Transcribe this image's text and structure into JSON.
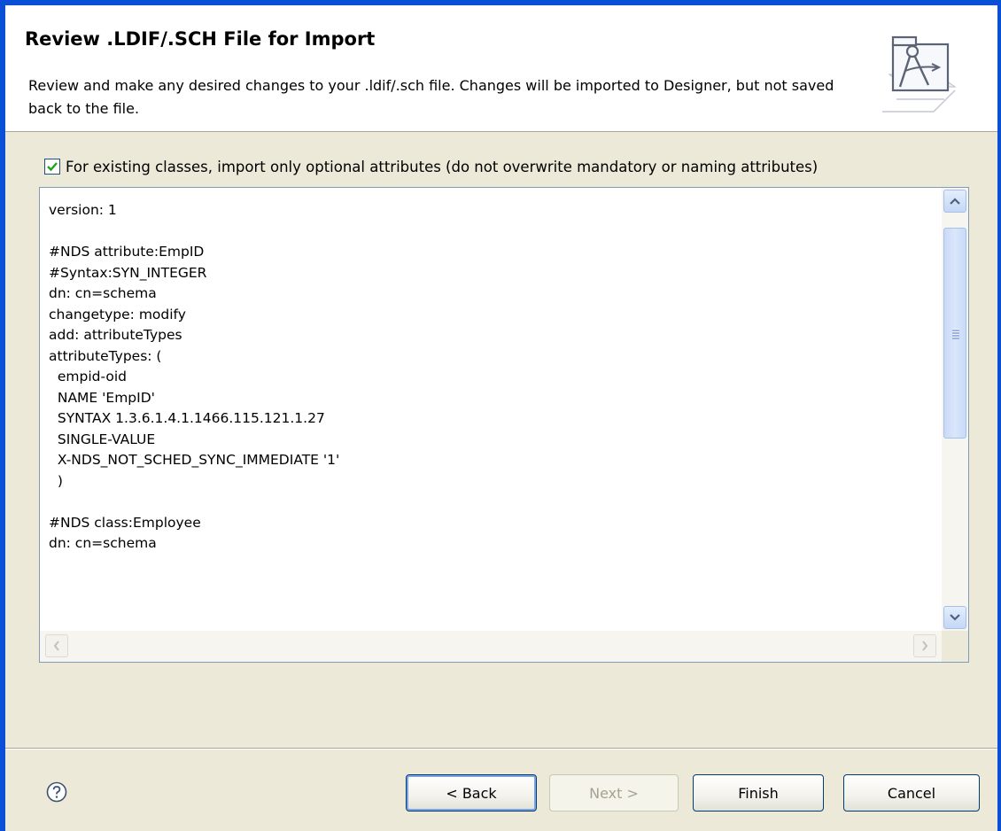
{
  "header": {
    "title": "Review .LDIF/.SCH File for Import",
    "description": "Review and make any desired changes to your .ldif/.sch file.  Changes will be imported to Designer, but not saved back to the file.",
    "icon": "schema-wizard-icon"
  },
  "option": {
    "label": "For existing classes, import only optional attributes (do not overwrite mandatory or naming attributes)",
    "checked": true
  },
  "editor": {
    "content": "version: 1\n\n#NDS attribute:EmpID\n#Syntax:SYN_INTEGER\ndn: cn=schema\nchangetype: modify\nadd: attributeTypes\nattributeTypes: (\n  empid-oid\n  NAME 'EmpID'\n  SYNTAX 1.3.6.1.4.1.1466.115.121.1.27\n  SINGLE-VALUE\n  X-NDS_NOT_SCHED_SYNC_IMMEDIATE '1'\n  )\n\n#NDS class:Employee\ndn: cn=schema"
  },
  "footer": {
    "help_icon": "question-mark-icon",
    "buttons": {
      "back": "< Back",
      "next": "Next >",
      "finish": "Finish",
      "cancel": "Cancel"
    }
  },
  "colors": {
    "window_border": "#0a4fd6",
    "dialog_background": "#ece9d8",
    "checkbox_check": "#21a121",
    "button_border": "#003c74"
  }
}
